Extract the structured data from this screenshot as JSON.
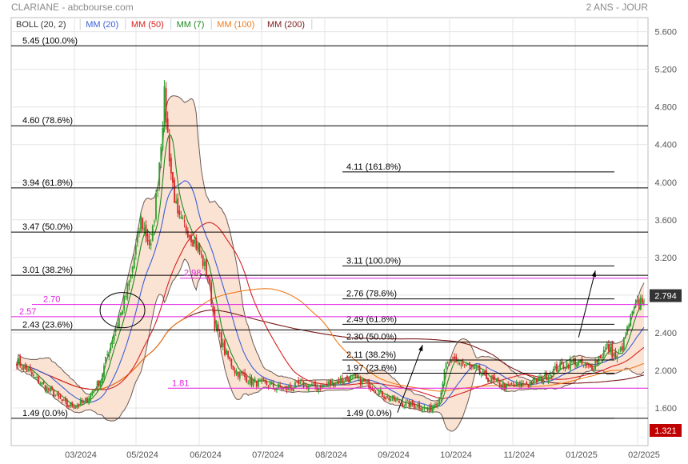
{
  "header": {
    "title": "CLARIANE - abcbourse.com",
    "period": "2 ANS - JOUR"
  },
  "legend": [
    {
      "label": "BOLL (20, 2)",
      "color": "#333333"
    },
    {
      "label": "MM (20)",
      "color": "#3a5fd8"
    },
    {
      "label": "MM (50)",
      "color": "#d82020"
    },
    {
      "label": "MM (7)",
      "color": "#1f8a1f"
    },
    {
      "label": "MM (100)",
      "color": "#f07a1a"
    },
    {
      "label": "MM (200)",
      "color": "#7a1a1a"
    }
  ],
  "colors": {
    "up": "#2ca02c",
    "down": "#d62728",
    "bollinger_fill": "#fbe3d3",
    "bollinger_line": "#6b5a55",
    "fib": "#000000",
    "support": "#e020e0",
    "price_badge": "#333333",
    "volume_badge": "#c00000"
  },
  "chart_data": {
    "type": "candlestick",
    "y_ticks": [
      "1.600",
      "2.000",
      "2.400",
      "2.800",
      "3.200",
      "3.600",
      "4.000",
      "4.400",
      "4.800",
      "5.200",
      "5.600"
    ],
    "ylim": [
      1.2,
      5.75
    ],
    "x_ticks": [
      "03/2024",
      "05/2024",
      "06/2024",
      "07/2024",
      "08/2024",
      "09/2024",
      "10/2024",
      "11/2024",
      "01/2025",
      "02/2025"
    ],
    "grid": true,
    "last_price": "2.794",
    "volume_badge": "1.321",
    "series": [
      {
        "name": "Cours",
        "anchors": [
          [
            0,
            2.1
          ],
          [
            12,
            1.9
          ],
          [
            22,
            1.75
          ],
          [
            30,
            1.62
          ],
          [
            40,
            1.65
          ],
          [
            50,
            1.9
          ],
          [
            56,
            2.3
          ],
          [
            62,
            2.6
          ],
          [
            68,
            3.0
          ],
          [
            74,
            3.6
          ],
          [
            80,
            3.3
          ],
          [
            84,
            4.0
          ],
          [
            88,
            4.9
          ],
          [
            92,
            4.1
          ],
          [
            96,
            3.6
          ],
          [
            102,
            3.5
          ],
          [
            108,
            3.3
          ],
          [
            114,
            3.0
          ],
          [
            118,
            2.5
          ],
          [
            124,
            2.2
          ],
          [
            130,
            2.0
          ],
          [
            140,
            1.88
          ],
          [
            150,
            1.85
          ],
          [
            160,
            1.8
          ],
          [
            170,
            1.85
          ],
          [
            180,
            1.82
          ],
          [
            190,
            1.88
          ],
          [
            200,
            1.92
          ],
          [
            210,
            1.85
          ],
          [
            220,
            1.72
          ],
          [
            230,
            1.65
          ],
          [
            240,
            1.62
          ],
          [
            246,
            1.58
          ],
          [
            252,
            1.72
          ],
          [
            256,
            2.05
          ],
          [
            262,
            2.1
          ],
          [
            272,
            2.02
          ],
          [
            282,
            1.9
          ],
          [
            292,
            1.82
          ],
          [
            302,
            1.85
          ],
          [
            312,
            1.9
          ],
          [
            322,
            2.02
          ],
          [
            332,
            2.1
          ],
          [
            342,
            2.02
          ],
          [
            352,
            2.25
          ],
          [
            358,
            2.12
          ],
          [
            362,
            2.3
          ],
          [
            366,
            2.55
          ],
          [
            370,
            2.7
          ],
          [
            374,
            2.79
          ]
        ],
        "candle_count": 375
      },
      {
        "name": "MM (7)",
        "source": "close",
        "period": 7
      },
      {
        "name": "MM (20)",
        "source": "close",
        "period": 20
      },
      {
        "name": "MM (50)",
        "source": "close",
        "period": 50
      },
      {
        "name": "MM (100)",
        "source": "close",
        "period": 100
      },
      {
        "name": "MM (200)",
        "source": "close",
        "period": 200
      }
    ],
    "bollinger": {
      "period": 20,
      "stddev": 2
    },
    "fibonacci_retracement": [
      {
        "label": "5.45  (100.0%)",
        "value": 5.45
      },
      {
        "label": "4.60  (78.6%)",
        "value": 4.6
      },
      {
        "label": "3.94  (61.8%)",
        "value": 3.94
      },
      {
        "label": "3.47  (50.0%)",
        "value": 3.47
      },
      {
        "label": "3.01  (38.2%)",
        "value": 3.01
      },
      {
        "label": "2.43  (23.6%)",
        "value": 2.43
      },
      {
        "label": "1.49  (0.0%)",
        "value": 1.49
      }
    ],
    "fibonacci_extension": [
      {
        "label": "4.11  (161.8%)",
        "value": 4.11
      },
      {
        "label": "3.11  (100.0%)",
        "value": 3.11
      },
      {
        "label": "2.76  (78.6%)",
        "value": 2.76
      },
      {
        "label": "2.49  (61.8%)",
        "value": 2.49
      },
      {
        "label": "2.30  (50.0%)",
        "value": 2.3
      },
      {
        "label": "2.11  (38.2%)",
        "value": 2.11
      },
      {
        "label": "1.97  (23.6%)",
        "value": 1.97
      },
      {
        "label": "1.49  (0.0%)",
        "value": 1.49
      }
    ],
    "support_lines": [
      {
        "label": "2.98",
        "value": 2.98
      },
      {
        "label": "2.70",
        "value": 2.7
      },
      {
        "label": "2.57",
        "value": 2.57
      },
      {
        "label": "1.81",
        "value": 1.81
      }
    ],
    "annotations": {
      "circle_center": {
        "index": 63,
        "value": 2.64
      },
      "arrows": [
        {
          "from": {
            "index": 227,
            "value": 1.55
          },
          "to": {
            "index": 242,
            "value": 2.27
          }
        },
        {
          "from": {
            "index": 335,
            "value": 2.35
          },
          "to": {
            "index": 345,
            "value": 3.06
          }
        }
      ]
    }
  }
}
